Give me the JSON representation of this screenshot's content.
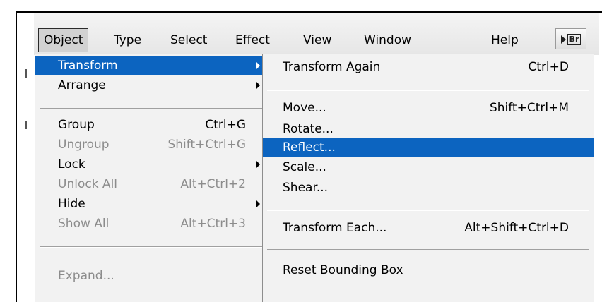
{
  "menubar": {
    "items": [
      "Object",
      "Type",
      "Select",
      "Effect",
      "View",
      "Window",
      "Help"
    ],
    "bridge_icon": "Br"
  },
  "object_menu": {
    "transform": "Transform",
    "arrange": "Arrange",
    "group": "Group",
    "group_sc": "Ctrl+G",
    "ungroup": "Ungroup",
    "ungroup_sc": "Shift+Ctrl+G",
    "lock": "Lock",
    "unlock_all": "Unlock All",
    "unlock_all_sc": "Alt+Ctrl+2",
    "hide": "Hide",
    "show_all": "Show All",
    "show_all_sc": "Alt+Ctrl+3",
    "expand": "Expand..."
  },
  "transform_menu": {
    "again": "Transform Again",
    "again_sc": "Ctrl+D",
    "move": "Move...",
    "move_sc": "Shift+Ctrl+M",
    "rotate": "Rotate...",
    "reflect": "Reflect...",
    "scale": "Scale...",
    "shear": "Shear...",
    "each": "Transform Each...",
    "each_sc": "Alt+Shift+Ctrl+D",
    "reset_bbox": "Reset Bounding Box"
  },
  "colors": {
    "highlight": "#0c64c0",
    "disabled": "#8c8c8c",
    "menu_bg": "#f2f2f2"
  }
}
